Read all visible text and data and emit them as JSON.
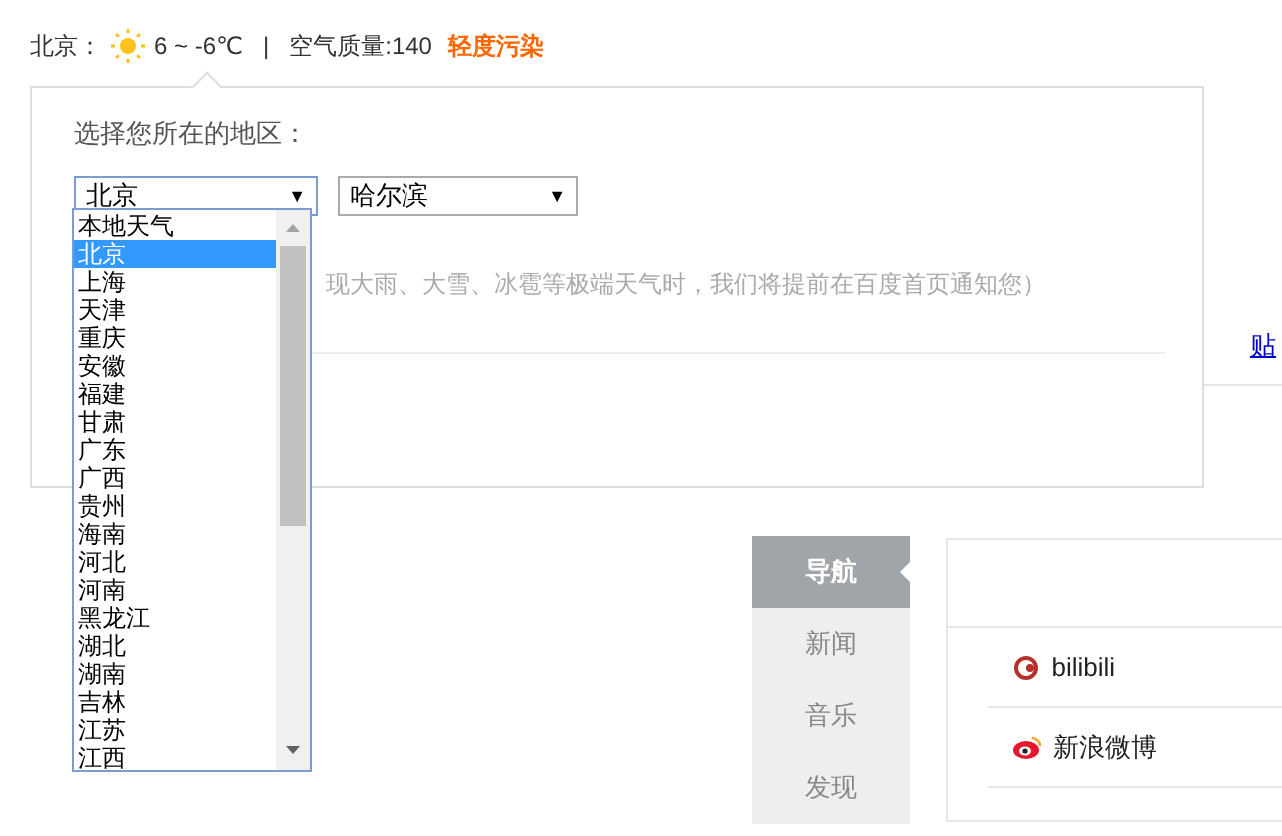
{
  "weather": {
    "city": "北京：",
    "temp": "6 ~ -6℃",
    "separator": "|",
    "aqi": "空气质量:140",
    "pollution": "轻度污染"
  },
  "region_popup": {
    "label": "选择您所在的地区：",
    "province": {
      "value": "北京",
      "caret": "▼",
      "expanded": true
    },
    "city": {
      "value": "哈尔滨",
      "caret": "▼"
    },
    "options": [
      {
        "label": "本地天气",
        "selected": false
      },
      {
        "label": "北京",
        "selected": true
      },
      {
        "label": "上海",
        "selected": false
      },
      {
        "label": "天津",
        "selected": false
      },
      {
        "label": "重庆",
        "selected": false
      },
      {
        "label": "安徽",
        "selected": false
      },
      {
        "label": "福建",
        "selected": false
      },
      {
        "label": "甘肃",
        "selected": false
      },
      {
        "label": "广东",
        "selected": false
      },
      {
        "label": "广西",
        "selected": false
      },
      {
        "label": "贵州",
        "selected": false
      },
      {
        "label": "海南",
        "selected": false
      },
      {
        "label": "河北",
        "selected": false
      },
      {
        "label": "河南",
        "selected": false
      },
      {
        "label": "黑龙江",
        "selected": false
      },
      {
        "label": "湖北",
        "selected": false
      },
      {
        "label": "湖南",
        "selected": false
      },
      {
        "label": "吉林",
        "selected": false
      },
      {
        "label": "江苏",
        "selected": false
      },
      {
        "label": "江西",
        "selected": false
      }
    ],
    "notice": "现大雨、大雪、冰雹等极端天气时，我们将提前在百度首页通知您）"
  },
  "top_link": "贴",
  "nav": [
    {
      "label": "导航",
      "selected": true
    },
    {
      "label": "新闻",
      "selected": false
    },
    {
      "label": "音乐",
      "selected": false
    },
    {
      "label": "发现",
      "selected": false
    }
  ],
  "sites": [
    {
      "label": "bilibili",
      "kind": "bilibili"
    },
    {
      "label": "新浪微博",
      "kind": "weibo"
    }
  ]
}
